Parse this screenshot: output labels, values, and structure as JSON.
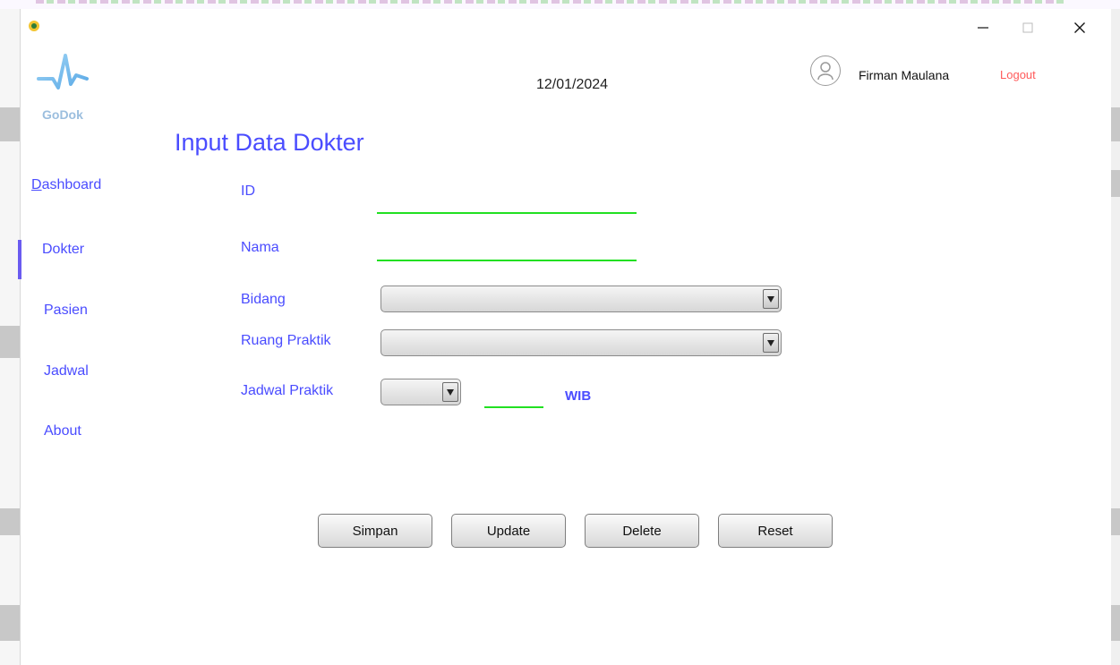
{
  "window": {
    "minimize_label": "—",
    "maximize_label": "☐",
    "close_label": "✕"
  },
  "header": {
    "logo_text": "GoDok",
    "date": "12/01/2024",
    "user_name": "Firman Maulana",
    "logout_label": "Logout"
  },
  "page_title": "Input Data Dokter",
  "sidebar": {
    "items": [
      {
        "label": "Dashboard",
        "mnemonic": "D",
        "rest": "ashboard"
      },
      {
        "label": "Dokter"
      },
      {
        "label": "Pasien"
      },
      {
        "label": "Jadwal"
      },
      {
        "label": "About"
      }
    ],
    "active": "Dokter"
  },
  "form": {
    "id_label": "ID",
    "id_value": "",
    "nama_label": "Nama",
    "nama_value": "",
    "bidang_label": "Bidang",
    "bidang_value": "",
    "ruang_label": "Ruang Praktik",
    "ruang_value": "",
    "jadwal_label": "Jadwal Praktik",
    "jadwal_value": "",
    "jam_value": "",
    "wib_label": "WIB"
  },
  "actions": {
    "simpan": "Simpan",
    "update": "Update",
    "delete": "Delete",
    "reset": "Reset"
  },
  "colors": {
    "accent": "#4a4cff",
    "logout": "#ff5a5a",
    "underline": "#22e022",
    "logo": "#9bbede"
  }
}
